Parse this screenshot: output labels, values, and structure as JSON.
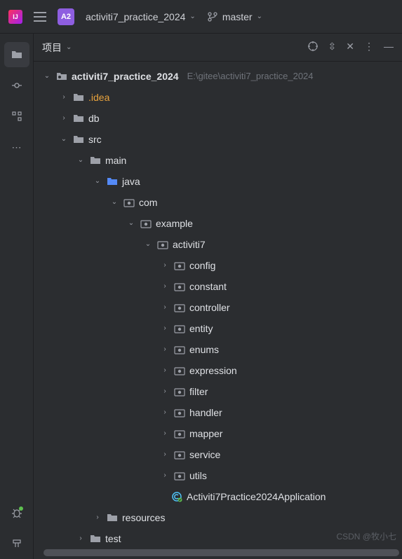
{
  "titlebar": {
    "badge": "A2",
    "project": "activiti7_practice_2024",
    "branch": "master"
  },
  "panel": {
    "title": "项目"
  },
  "tree": {
    "root_name": "activiti7_practice_2024",
    "root_path": "E:\\gitee\\activiti7_practice_2024",
    "idea": ".idea",
    "db": "db",
    "src": "src",
    "main": "main",
    "java": "java",
    "com": "com",
    "example": "example",
    "activiti7": "activiti7",
    "pkgs": {
      "config": "config",
      "constant": "constant",
      "controller": "controller",
      "entity": "entity",
      "enums": "enums",
      "expression": "expression",
      "filter": "filter",
      "handler": "handler",
      "mapper": "mapper",
      "service": "service",
      "utils": "utils"
    },
    "app_class": "Activiti7Practice2024Application",
    "resources": "resources",
    "test": "test"
  },
  "watermark": "CSDN @牧小七"
}
